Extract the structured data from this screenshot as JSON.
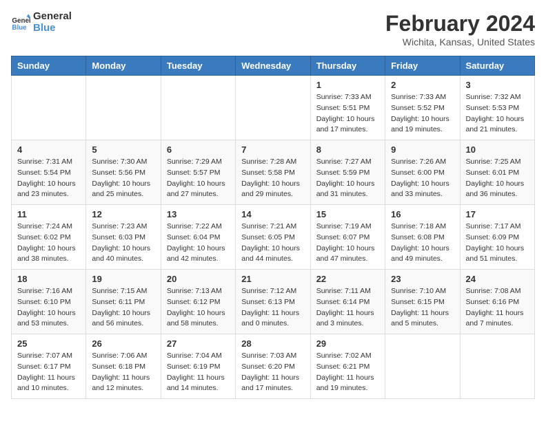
{
  "header": {
    "logo_line1": "General",
    "logo_line2": "Blue",
    "title": "February 2024",
    "subtitle": "Wichita, Kansas, United States"
  },
  "columns": [
    "Sunday",
    "Monday",
    "Tuesday",
    "Wednesday",
    "Thursday",
    "Friday",
    "Saturday"
  ],
  "weeks": [
    [
      {
        "day": "",
        "info": ""
      },
      {
        "day": "",
        "info": ""
      },
      {
        "day": "",
        "info": ""
      },
      {
        "day": "",
        "info": ""
      },
      {
        "day": "1",
        "info": "Sunrise: 7:33 AM\nSunset: 5:51 PM\nDaylight: 10 hours\nand 17 minutes."
      },
      {
        "day": "2",
        "info": "Sunrise: 7:33 AM\nSunset: 5:52 PM\nDaylight: 10 hours\nand 19 minutes."
      },
      {
        "day": "3",
        "info": "Sunrise: 7:32 AM\nSunset: 5:53 PM\nDaylight: 10 hours\nand 21 minutes."
      }
    ],
    [
      {
        "day": "4",
        "info": "Sunrise: 7:31 AM\nSunset: 5:54 PM\nDaylight: 10 hours\nand 23 minutes."
      },
      {
        "day": "5",
        "info": "Sunrise: 7:30 AM\nSunset: 5:56 PM\nDaylight: 10 hours\nand 25 minutes."
      },
      {
        "day": "6",
        "info": "Sunrise: 7:29 AM\nSunset: 5:57 PM\nDaylight: 10 hours\nand 27 minutes."
      },
      {
        "day": "7",
        "info": "Sunrise: 7:28 AM\nSunset: 5:58 PM\nDaylight: 10 hours\nand 29 minutes."
      },
      {
        "day": "8",
        "info": "Sunrise: 7:27 AM\nSunset: 5:59 PM\nDaylight: 10 hours\nand 31 minutes."
      },
      {
        "day": "9",
        "info": "Sunrise: 7:26 AM\nSunset: 6:00 PM\nDaylight: 10 hours\nand 33 minutes."
      },
      {
        "day": "10",
        "info": "Sunrise: 7:25 AM\nSunset: 6:01 PM\nDaylight: 10 hours\nand 36 minutes."
      }
    ],
    [
      {
        "day": "11",
        "info": "Sunrise: 7:24 AM\nSunset: 6:02 PM\nDaylight: 10 hours\nand 38 minutes."
      },
      {
        "day": "12",
        "info": "Sunrise: 7:23 AM\nSunset: 6:03 PM\nDaylight: 10 hours\nand 40 minutes."
      },
      {
        "day": "13",
        "info": "Sunrise: 7:22 AM\nSunset: 6:04 PM\nDaylight: 10 hours\nand 42 minutes."
      },
      {
        "day": "14",
        "info": "Sunrise: 7:21 AM\nSunset: 6:05 PM\nDaylight: 10 hours\nand 44 minutes."
      },
      {
        "day": "15",
        "info": "Sunrise: 7:19 AM\nSunset: 6:07 PM\nDaylight: 10 hours\nand 47 minutes."
      },
      {
        "day": "16",
        "info": "Sunrise: 7:18 AM\nSunset: 6:08 PM\nDaylight: 10 hours\nand 49 minutes."
      },
      {
        "day": "17",
        "info": "Sunrise: 7:17 AM\nSunset: 6:09 PM\nDaylight: 10 hours\nand 51 minutes."
      }
    ],
    [
      {
        "day": "18",
        "info": "Sunrise: 7:16 AM\nSunset: 6:10 PM\nDaylight: 10 hours\nand 53 minutes."
      },
      {
        "day": "19",
        "info": "Sunrise: 7:15 AM\nSunset: 6:11 PM\nDaylight: 10 hours\nand 56 minutes."
      },
      {
        "day": "20",
        "info": "Sunrise: 7:13 AM\nSunset: 6:12 PM\nDaylight: 10 hours\nand 58 minutes."
      },
      {
        "day": "21",
        "info": "Sunrise: 7:12 AM\nSunset: 6:13 PM\nDaylight: 11 hours\nand 0 minutes."
      },
      {
        "day": "22",
        "info": "Sunrise: 7:11 AM\nSunset: 6:14 PM\nDaylight: 11 hours\nand 3 minutes."
      },
      {
        "day": "23",
        "info": "Sunrise: 7:10 AM\nSunset: 6:15 PM\nDaylight: 11 hours\nand 5 minutes."
      },
      {
        "day": "24",
        "info": "Sunrise: 7:08 AM\nSunset: 6:16 PM\nDaylight: 11 hours\nand 7 minutes."
      }
    ],
    [
      {
        "day": "25",
        "info": "Sunrise: 7:07 AM\nSunset: 6:17 PM\nDaylight: 11 hours\nand 10 minutes."
      },
      {
        "day": "26",
        "info": "Sunrise: 7:06 AM\nSunset: 6:18 PM\nDaylight: 11 hours\nand 12 minutes."
      },
      {
        "day": "27",
        "info": "Sunrise: 7:04 AM\nSunset: 6:19 PM\nDaylight: 11 hours\nand 14 minutes."
      },
      {
        "day": "28",
        "info": "Sunrise: 7:03 AM\nSunset: 6:20 PM\nDaylight: 11 hours\nand 17 minutes."
      },
      {
        "day": "29",
        "info": "Sunrise: 7:02 AM\nSunset: 6:21 PM\nDaylight: 11 hours\nand 19 minutes."
      },
      {
        "day": "",
        "info": ""
      },
      {
        "day": "",
        "info": ""
      }
    ]
  ]
}
